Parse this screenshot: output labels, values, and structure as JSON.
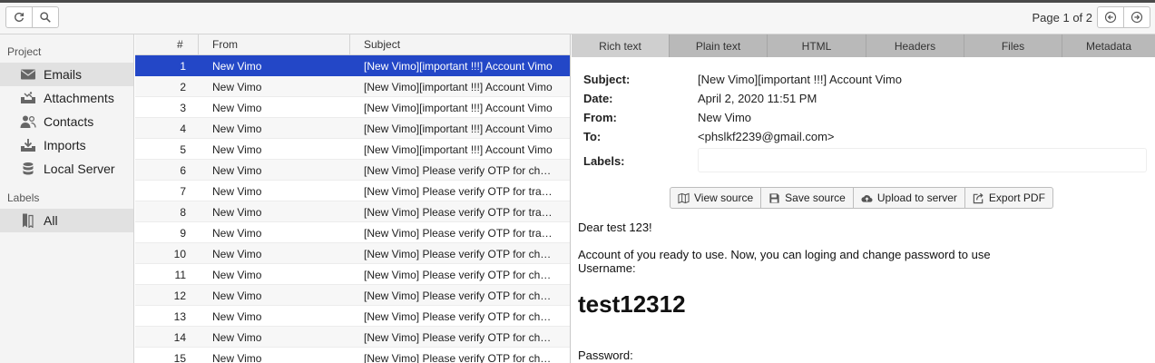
{
  "toolbar": {
    "refresh_icon": "refresh-icon",
    "search_icon": "search-icon",
    "page_info": "Page 1 of 2",
    "prev_icon": "arrow-left-circle-icon",
    "next_icon": "arrow-right-circle-icon"
  },
  "sidebar": {
    "project_heading": "Project",
    "items": [
      {
        "label": "Emails",
        "icon": "envelope-icon"
      },
      {
        "label": "Attachments",
        "icon": "image-tray-icon"
      },
      {
        "label": "Contacts",
        "icon": "contacts-icon"
      },
      {
        "label": "Imports",
        "icon": "import-icon"
      },
      {
        "label": "Local Server",
        "icon": "database-icon"
      }
    ],
    "labels_heading": "Labels",
    "label_items": [
      {
        "label": "All",
        "icon": "bookmarks-icon"
      }
    ]
  },
  "list": {
    "columns": [
      "#",
      "From",
      "Subject"
    ],
    "rows": [
      {
        "num": "1",
        "from": "New Vimo",
        "subject": "[New Vimo][important !!!] Account Vimo"
      },
      {
        "num": "2",
        "from": "New Vimo",
        "subject": "[New Vimo][important !!!] Account Vimo"
      },
      {
        "num": "3",
        "from": "New Vimo",
        "subject": "[New Vimo][important !!!] Account Vimo"
      },
      {
        "num": "4",
        "from": "New Vimo",
        "subject": "[New Vimo][important !!!] Account Vimo"
      },
      {
        "num": "5",
        "from": "New Vimo",
        "subject": "[New Vimo][important !!!] Account Vimo"
      },
      {
        "num": "6",
        "from": "New Vimo",
        "subject": "[New Vimo] Please verify OTP for ch…"
      },
      {
        "num": "7",
        "from": "New Vimo",
        "subject": "[New Vimo] Please verify OTP for tra…"
      },
      {
        "num": "8",
        "from": "New Vimo",
        "subject": "[New Vimo] Please verify OTP for tra…"
      },
      {
        "num": "9",
        "from": "New Vimo",
        "subject": "[New Vimo] Please verify OTP for tra…"
      },
      {
        "num": "10",
        "from": "New Vimo",
        "subject": "[New Vimo] Please verify OTP for ch…"
      },
      {
        "num": "11",
        "from": "New Vimo",
        "subject": "[New Vimo] Please verify OTP for ch…"
      },
      {
        "num": "12",
        "from": "New Vimo",
        "subject": "[New Vimo] Please verify OTP for ch…"
      },
      {
        "num": "13",
        "from": "New Vimo",
        "subject": "[New Vimo] Please verify OTP for ch…"
      },
      {
        "num": "14",
        "from": "New Vimo",
        "subject": "[New Vimo] Please verify OTP for ch…"
      },
      {
        "num": "15",
        "from": "New Vimo",
        "subject": "[New Vimo] Please verify OTP for ch…"
      }
    ]
  },
  "detail": {
    "tabs": [
      "Rich text",
      "Plain text",
      "HTML",
      "Headers",
      "Files",
      "Metadata"
    ],
    "meta": {
      "subject_label": "Subject:",
      "subject_value": "[New Vimo][important !!!] Account Vimo",
      "date_label": "Date:",
      "date_value": "April 2, 2020 11:51 PM",
      "from_label": "From:",
      "from_value": "New Vimo",
      "to_label": "To:",
      "to_value": "<phslkf2239@gmail.com>",
      "labels_label": "Labels:"
    },
    "actions": [
      {
        "label": "View source",
        "icon": "map-icon"
      },
      {
        "label": "Save source",
        "icon": "save-icon"
      },
      {
        "label": "Upload to server",
        "icon": "cloud-upload-icon"
      },
      {
        "label": "Export PDF",
        "icon": "export-icon"
      }
    ],
    "body": {
      "greeting": "Dear test 123!",
      "line1": "Account of you ready to use. Now, you can loging and change password to use",
      "username_label": "Username:",
      "username_value": "test12312",
      "password_label": "Password:"
    }
  },
  "colors": {
    "selection": "#2347c7",
    "tab_bar": "#b9b9b9",
    "sidebar_bg": "#f4f4f4"
  }
}
